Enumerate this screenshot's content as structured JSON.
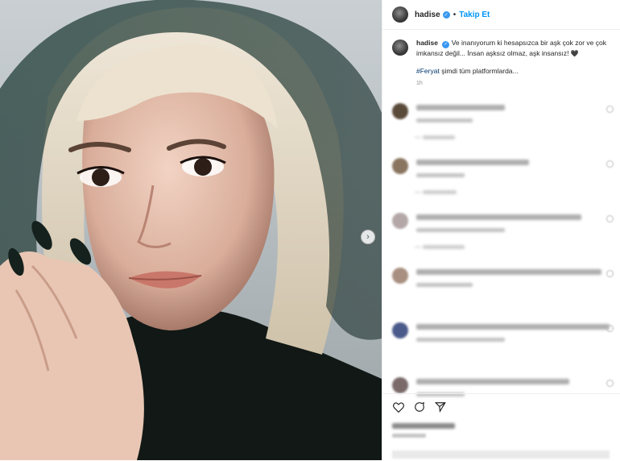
{
  "header": {
    "username": "hadise",
    "follow_label": "Takip Et",
    "dot": "•"
  },
  "caption": {
    "username": "hadise",
    "text": "Ve inanıyorum ki hesapsızca bir aşk çok zor ve çok imkansız değil... İnsan aşksız olmaz, aşk insansız!",
    "heart": "🖤",
    "hashtag": "#Feryat",
    "text2": " şimdi tüm platformlarda...",
    "time": "1h"
  },
  "comments": [
    {
      "avatar_color": "#5a4a3a",
      "line_w": 110,
      "meta_w": 70,
      "reply_w": 40
    },
    {
      "avatar_color": "#8a7560",
      "line_w": 140,
      "meta_w": 60,
      "reply_w": 42
    },
    {
      "avatar_color": "#b4a7a7",
      "line_w": 205,
      "meta_w": 110,
      "reply_w": 52
    },
    {
      "avatar_color": "#a88f7f",
      "line_w": 230,
      "meta_w": 70,
      "reply_w": 0
    },
    {
      "avatar_color": "#4a5a8a",
      "line_w": 240,
      "meta_w": 110,
      "reply_w": 0
    },
    {
      "avatar_color": "#7a6a6a",
      "line_w": 190,
      "meta_w": 60,
      "reply_w": 0
    }
  ],
  "icons": [
    "heart-outline-icon",
    "comment-icon",
    "share-icon"
  ],
  "colors": {
    "accent": "#0095f6",
    "verified": "#3897f0",
    "border": "#efefef"
  }
}
